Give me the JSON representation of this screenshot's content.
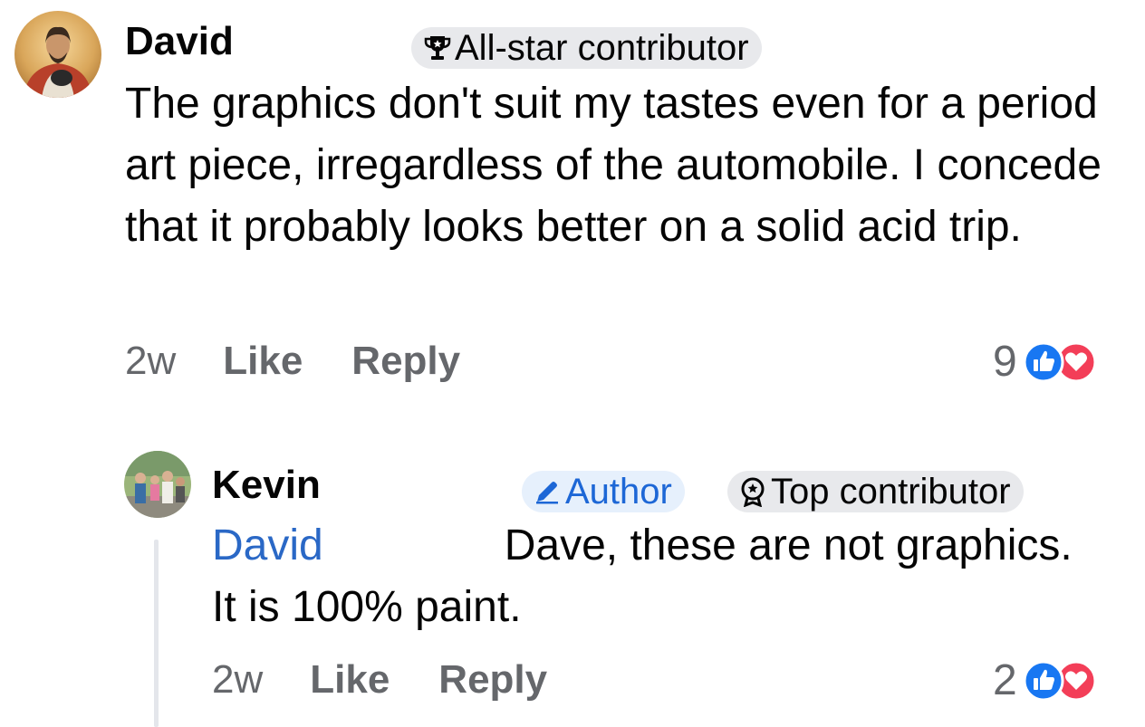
{
  "comments": [
    {
      "author": "David",
      "badge": {
        "label": "All-star contributor",
        "icon": "trophy-icon"
      },
      "text": "The graphics don't suit my tastes even for a period art piece, irregardless of the automobile. I concede that it probably looks better on a solid acid trip.",
      "time": "2w",
      "like_label": "Like",
      "reply_label": "Reply",
      "reaction_count": "9",
      "reactions": [
        "like-icon",
        "love-icon"
      ]
    },
    {
      "author": "Kevin",
      "badges": [
        {
          "label": "Author",
          "icon": "pencil-icon",
          "color": "#1d67d6"
        },
        {
          "label": "Top contributor",
          "icon": "medal-icon"
        }
      ],
      "mention": "David",
      "text": "Dave, these are not graphics. It is 100% paint.",
      "time": "2w",
      "like_label": "Like",
      "reply_label": "Reply",
      "reaction_count": "2",
      "reactions": [
        "like-icon",
        "love-icon"
      ]
    }
  ],
  "colors": {
    "like_blue": "#1877f2",
    "love_red": "#f33e58",
    "mention_blue": "#2a68c6",
    "muted_gray": "#65676b"
  }
}
